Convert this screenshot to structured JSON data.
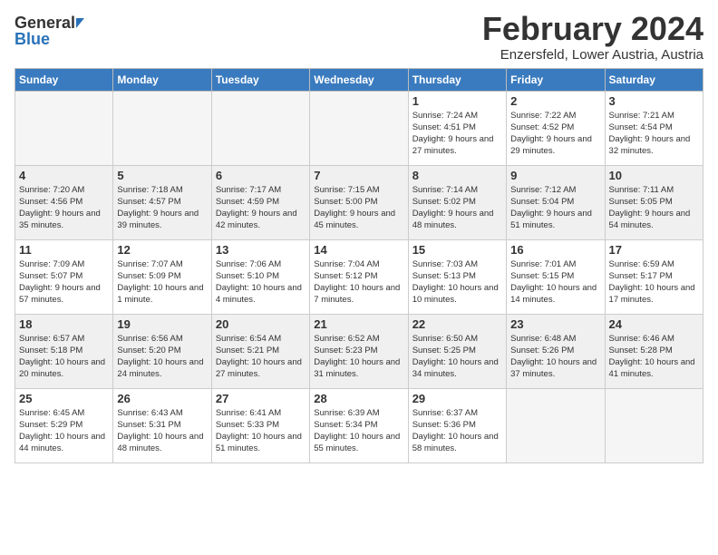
{
  "logo": {
    "general": "General",
    "blue": "Blue"
  },
  "title": {
    "month_year": "February 2024",
    "location": "Enzersfeld, Lower Austria, Austria"
  },
  "weekdays": [
    "Sunday",
    "Monday",
    "Tuesday",
    "Wednesday",
    "Thursday",
    "Friday",
    "Saturday"
  ],
  "weeks": [
    [
      {
        "day": "",
        "detail": ""
      },
      {
        "day": "",
        "detail": ""
      },
      {
        "day": "",
        "detail": ""
      },
      {
        "day": "",
        "detail": ""
      },
      {
        "day": "1",
        "detail": "Sunrise: 7:24 AM\nSunset: 4:51 PM\nDaylight: 9 hours\nand 27 minutes."
      },
      {
        "day": "2",
        "detail": "Sunrise: 7:22 AM\nSunset: 4:52 PM\nDaylight: 9 hours\nand 29 minutes."
      },
      {
        "day": "3",
        "detail": "Sunrise: 7:21 AM\nSunset: 4:54 PM\nDaylight: 9 hours\nand 32 minutes."
      }
    ],
    [
      {
        "day": "4",
        "detail": "Sunrise: 7:20 AM\nSunset: 4:56 PM\nDaylight: 9 hours\nand 35 minutes."
      },
      {
        "day": "5",
        "detail": "Sunrise: 7:18 AM\nSunset: 4:57 PM\nDaylight: 9 hours\nand 39 minutes."
      },
      {
        "day": "6",
        "detail": "Sunrise: 7:17 AM\nSunset: 4:59 PM\nDaylight: 9 hours\nand 42 minutes."
      },
      {
        "day": "7",
        "detail": "Sunrise: 7:15 AM\nSunset: 5:00 PM\nDaylight: 9 hours\nand 45 minutes."
      },
      {
        "day": "8",
        "detail": "Sunrise: 7:14 AM\nSunset: 5:02 PM\nDaylight: 9 hours\nand 48 minutes."
      },
      {
        "day": "9",
        "detail": "Sunrise: 7:12 AM\nSunset: 5:04 PM\nDaylight: 9 hours\nand 51 minutes."
      },
      {
        "day": "10",
        "detail": "Sunrise: 7:11 AM\nSunset: 5:05 PM\nDaylight: 9 hours\nand 54 minutes."
      }
    ],
    [
      {
        "day": "11",
        "detail": "Sunrise: 7:09 AM\nSunset: 5:07 PM\nDaylight: 9 hours\nand 57 minutes."
      },
      {
        "day": "12",
        "detail": "Sunrise: 7:07 AM\nSunset: 5:09 PM\nDaylight: 10 hours\nand 1 minute."
      },
      {
        "day": "13",
        "detail": "Sunrise: 7:06 AM\nSunset: 5:10 PM\nDaylight: 10 hours\nand 4 minutes."
      },
      {
        "day": "14",
        "detail": "Sunrise: 7:04 AM\nSunset: 5:12 PM\nDaylight: 10 hours\nand 7 minutes."
      },
      {
        "day": "15",
        "detail": "Sunrise: 7:03 AM\nSunset: 5:13 PM\nDaylight: 10 hours\nand 10 minutes."
      },
      {
        "day": "16",
        "detail": "Sunrise: 7:01 AM\nSunset: 5:15 PM\nDaylight: 10 hours\nand 14 minutes."
      },
      {
        "day": "17",
        "detail": "Sunrise: 6:59 AM\nSunset: 5:17 PM\nDaylight: 10 hours\nand 17 minutes."
      }
    ],
    [
      {
        "day": "18",
        "detail": "Sunrise: 6:57 AM\nSunset: 5:18 PM\nDaylight: 10 hours\nand 20 minutes."
      },
      {
        "day": "19",
        "detail": "Sunrise: 6:56 AM\nSunset: 5:20 PM\nDaylight: 10 hours\nand 24 minutes."
      },
      {
        "day": "20",
        "detail": "Sunrise: 6:54 AM\nSunset: 5:21 PM\nDaylight: 10 hours\nand 27 minutes."
      },
      {
        "day": "21",
        "detail": "Sunrise: 6:52 AM\nSunset: 5:23 PM\nDaylight: 10 hours\nand 31 minutes."
      },
      {
        "day": "22",
        "detail": "Sunrise: 6:50 AM\nSunset: 5:25 PM\nDaylight: 10 hours\nand 34 minutes."
      },
      {
        "day": "23",
        "detail": "Sunrise: 6:48 AM\nSunset: 5:26 PM\nDaylight: 10 hours\nand 37 minutes."
      },
      {
        "day": "24",
        "detail": "Sunrise: 6:46 AM\nSunset: 5:28 PM\nDaylight: 10 hours\nand 41 minutes."
      }
    ],
    [
      {
        "day": "25",
        "detail": "Sunrise: 6:45 AM\nSunset: 5:29 PM\nDaylight: 10 hours\nand 44 minutes."
      },
      {
        "day": "26",
        "detail": "Sunrise: 6:43 AM\nSunset: 5:31 PM\nDaylight: 10 hours\nand 48 minutes."
      },
      {
        "day": "27",
        "detail": "Sunrise: 6:41 AM\nSunset: 5:33 PM\nDaylight: 10 hours\nand 51 minutes."
      },
      {
        "day": "28",
        "detail": "Sunrise: 6:39 AM\nSunset: 5:34 PM\nDaylight: 10 hours\nand 55 minutes."
      },
      {
        "day": "29",
        "detail": "Sunrise: 6:37 AM\nSunset: 5:36 PM\nDaylight: 10 hours\nand 58 minutes."
      },
      {
        "day": "",
        "detail": ""
      },
      {
        "day": "",
        "detail": ""
      }
    ]
  ]
}
